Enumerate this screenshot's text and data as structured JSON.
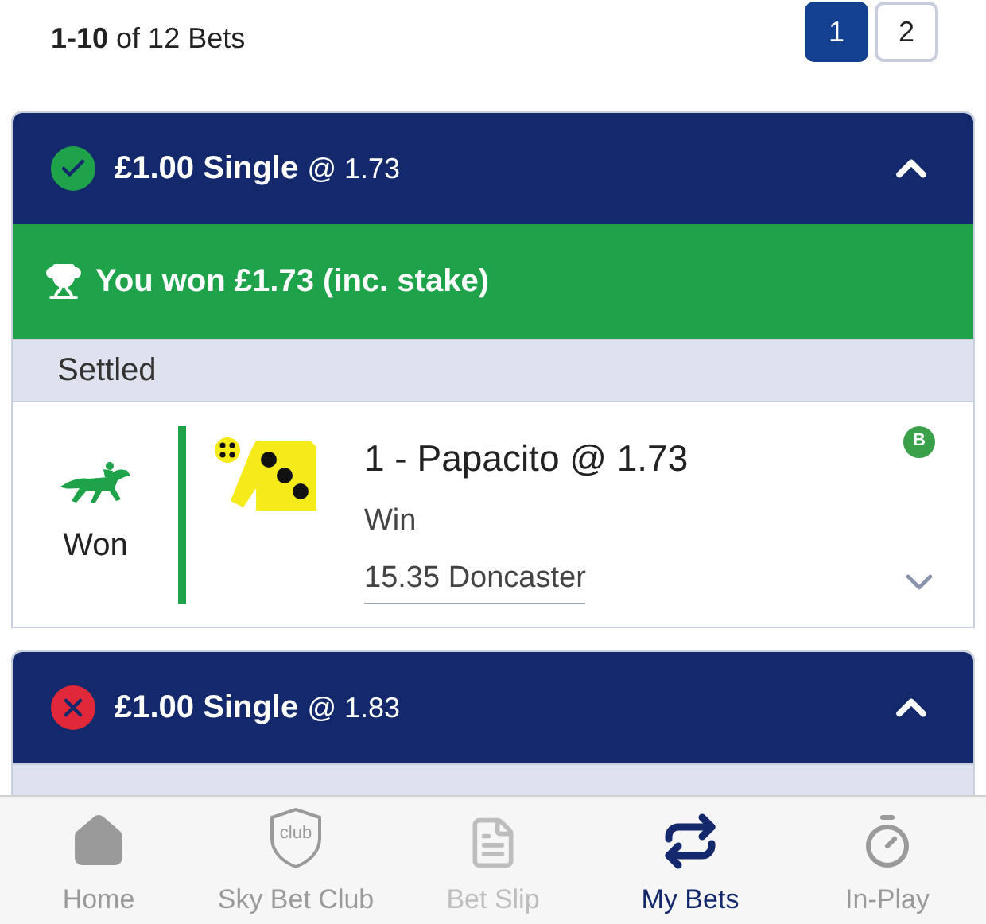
{
  "pagination": {
    "summary_bold": "1-10",
    "summary_rest": "of 12 Bets",
    "pages": [
      {
        "label": "1",
        "selected": true
      },
      {
        "label": "2",
        "selected": false
      }
    ]
  },
  "bets": [
    {
      "kind": "won",
      "stake": "£1.00 Single",
      "odds": "@ 1.73",
      "expanded": true,
      "banner": "You won £1.73 (inc. stake)",
      "section": "Settled",
      "selection": {
        "result": "Won",
        "name": "1 - Papacito @ 1.73",
        "market": "Win",
        "event": "15.35 Doncaster",
        "badge": "B"
      }
    },
    {
      "kind": "lost",
      "stake": "£1.00 Single",
      "odds": "@ 1.83",
      "expanded": true
    }
  ],
  "nav": [
    {
      "kind": "home",
      "label": "Home",
      "selected": false,
      "disabled": false
    },
    {
      "kind": "club",
      "label": "Sky Bet Club",
      "icon_text": "club",
      "selected": false,
      "disabled": false
    },
    {
      "kind": "slip",
      "label": "Bet Slip",
      "selected": false,
      "disabled": true
    },
    {
      "kind": "mybets",
      "label": "My Bets",
      "selected": true,
      "disabled": false
    },
    {
      "kind": "inplay",
      "label": "In-Play",
      "selected": false,
      "disabled": false
    }
  ]
}
